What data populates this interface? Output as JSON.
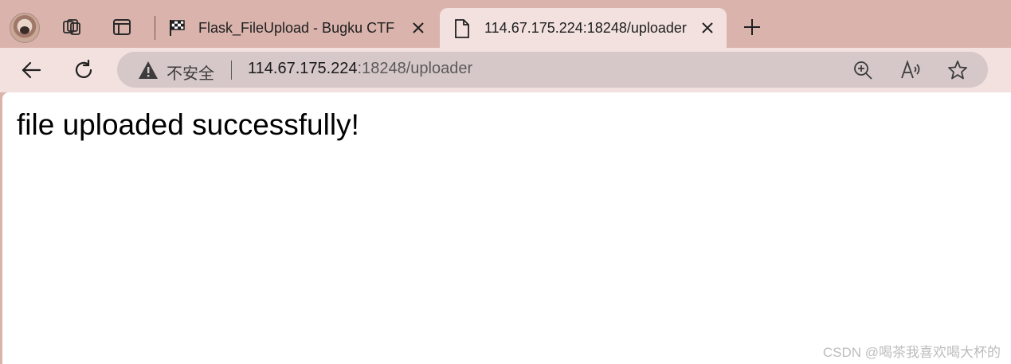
{
  "tabs": [
    {
      "title": "Flask_FileUpload - Bugku CTF",
      "icon": "checkered-flag-icon",
      "active": false
    },
    {
      "title": "114.67.175.224:18248/uploader",
      "icon": "document-icon",
      "active": true
    }
  ],
  "address_bar": {
    "security_label": "不安全",
    "url_host": "114.67.175.224",
    "url_rest": ":18248/uploader"
  },
  "page": {
    "heading": "file uploaded successfully!"
  },
  "watermark": "CSDN @喝茶我喜欢喝大杯的",
  "colors": {
    "tabstrip": "#d9b3ac",
    "toolbar": "#f2e1df",
    "address_bar": "#d6c8c8",
    "page": "#ffffff"
  }
}
